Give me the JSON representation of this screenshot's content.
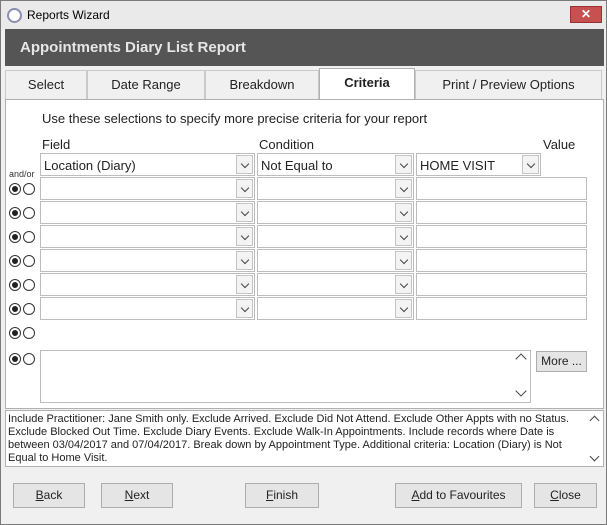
{
  "window": {
    "title": "Reports Wizard",
    "close_label": "✕"
  },
  "header": {
    "title": "Appointments Diary List Report"
  },
  "tabs": [
    {
      "label": "Select",
      "active": false
    },
    {
      "label": "Date Range",
      "active": false
    },
    {
      "label": "Breakdown",
      "active": false
    },
    {
      "label": "Criteria",
      "active": true
    },
    {
      "label": "Print / Preview Options",
      "active": false
    }
  ],
  "criteria": {
    "instructions": "Use these selections to specify more precise criteria for your report",
    "headers": {
      "field": "Field",
      "condition": "Condition",
      "value": "Value",
      "andor": "and/or"
    },
    "rows": [
      {
        "field": "Location (Diary)",
        "condition": "Not Equal to",
        "value": "HOME VISIT"
      },
      {
        "field": "",
        "condition": "",
        "value": ""
      },
      {
        "field": "",
        "condition": "",
        "value": ""
      },
      {
        "field": "",
        "condition": "",
        "value": ""
      },
      {
        "field": "",
        "condition": "",
        "value": ""
      },
      {
        "field": "",
        "condition": "",
        "value": ""
      },
      {
        "field": "",
        "condition": "",
        "value": ""
      }
    ],
    "more_label": "More ..."
  },
  "summary": {
    "text": "Include Practitioner: Jane Smith only. Exclude Arrived. Exclude Did Not Attend. Exclude Other Appts with no Status. Exclude Blocked Out Time. Exclude Diary Events. Exclude Walk-In Appointments. Include records where Date is between 03/04/2017 and 07/04/2017. Break down by Appointment Type. Additional criteria: Location (Diary) is Not Equal to Home Visit."
  },
  "buttons": {
    "back": {
      "first": "B",
      "rest": "ack"
    },
    "next": {
      "first": "N",
      "rest": "ext"
    },
    "finish": {
      "first": "F",
      "rest": "inish"
    },
    "favourites": {
      "first": "A",
      "rest": "dd to Favourites"
    },
    "close": {
      "first": "C",
      "rest": "lose"
    }
  },
  "colors": {
    "header_bg": "#555555",
    "header_text": "#e6e6e6",
    "close_red": "#c75050"
  }
}
